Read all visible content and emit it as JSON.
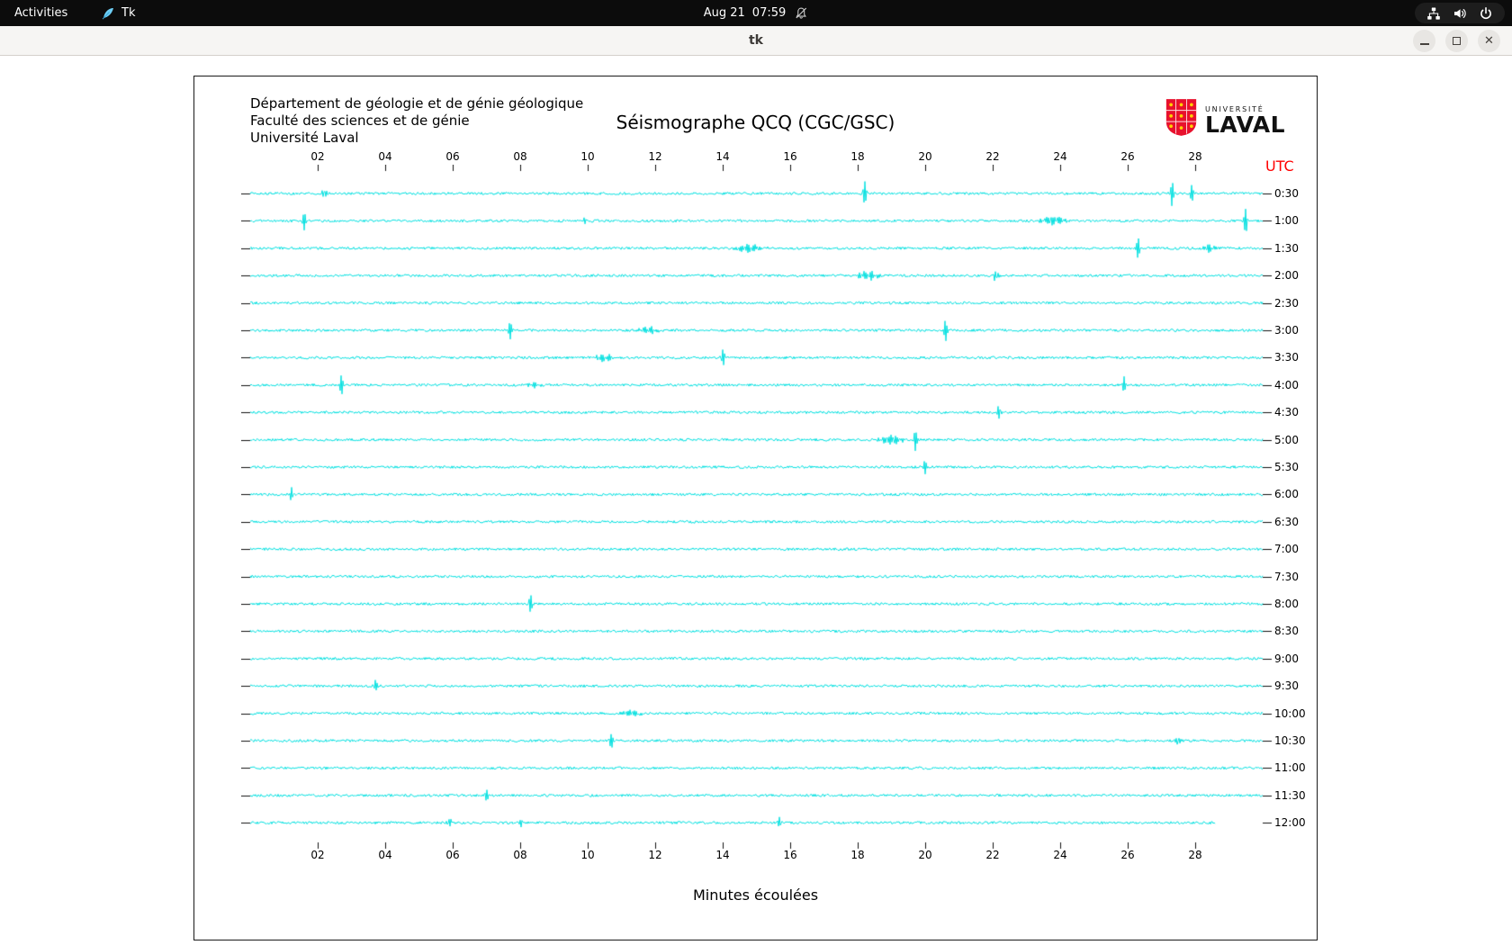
{
  "top_bar": {
    "activities_label": "Activities",
    "tk_label": "Tk",
    "clock_date": "Aug 21",
    "clock_time": "07:59"
  },
  "window": {
    "title": "tk"
  },
  "seismograph": {
    "org_lines": [
      "Département de géologie et de génie géologique",
      "Faculté des sciences et de génie",
      "Université Laval"
    ],
    "title": "Séismographe QCQ (CGC/GSC)",
    "logo": {
      "top": "UNIVERSITÉ",
      "bottom": "LAVAL"
    },
    "utc_label": "UTC",
    "x_label": "Minutes écoulées",
    "x_ticks": [
      "02",
      "04",
      "06",
      "08",
      "10",
      "12",
      "14",
      "16",
      "18",
      "20",
      "22",
      "24",
      "26",
      "28"
    ],
    "trace_color": "#00e0e0",
    "rows": [
      {
        "label": "0:30",
        "spikes": [
          [
            2.2,
            12,
            2
          ],
          [
            18.2,
            14,
            2
          ],
          [
            27.3,
            16,
            2
          ],
          [
            27.9,
            9,
            2
          ]
        ]
      },
      {
        "label": "1:00",
        "spikes": [
          [
            1.6,
            10,
            2
          ],
          [
            9.9,
            6,
            2
          ],
          [
            23.8,
            5,
            12
          ],
          [
            29.5,
            14,
            2
          ]
        ]
      },
      {
        "label": "1:30",
        "spikes": [
          [
            14.8,
            5,
            14
          ],
          [
            26.3,
            11,
            2
          ],
          [
            28.4,
            4,
            6
          ]
        ]
      },
      {
        "label": "2:00",
        "spikes": [
          [
            18.3,
            5,
            12
          ],
          [
            22.1,
            12,
            2
          ]
        ]
      },
      {
        "label": "2:30",
        "spikes": []
      },
      {
        "label": "3:00",
        "spikes": [
          [
            7.7,
            11,
            2
          ],
          [
            11.8,
            4,
            10
          ],
          [
            20.6,
            12,
            2
          ]
        ]
      },
      {
        "label": "3:30",
        "spikes": [
          [
            10.5,
            4,
            10
          ],
          [
            14.0,
            12,
            2
          ]
        ]
      },
      {
        "label": "4:00",
        "spikes": [
          [
            2.7,
            11,
            2
          ],
          [
            8.4,
            3,
            6
          ],
          [
            25.9,
            11,
            2
          ]
        ]
      },
      {
        "label": "4:30",
        "spikes": [
          [
            22.2,
            12,
            2
          ]
        ]
      },
      {
        "label": "5:00",
        "spikes": [
          [
            19.0,
            5,
            12
          ],
          [
            19.7,
            12,
            2
          ]
        ]
      },
      {
        "label": "5:30",
        "spikes": [
          [
            20.0,
            8,
            2
          ]
        ]
      },
      {
        "label": "6:00",
        "spikes": [
          [
            1.2,
            10,
            2
          ]
        ]
      },
      {
        "label": "6:30",
        "spikes": []
      },
      {
        "label": "7:00",
        "spikes": []
      },
      {
        "label": "7:30",
        "spikes": []
      },
      {
        "label": "8:00",
        "spikes": [
          [
            8.3,
            10,
            2
          ]
        ]
      },
      {
        "label": "8:30",
        "spikes": []
      },
      {
        "label": "9:00",
        "spikes": []
      },
      {
        "label": "9:30",
        "spikes": [
          [
            3.7,
            9,
            2
          ]
        ]
      },
      {
        "label": "10:00",
        "spikes": [
          [
            11.3,
            4,
            10
          ]
        ]
      },
      {
        "label": "10:30",
        "spikes": [
          [
            10.7,
            9,
            2
          ],
          [
            27.5,
            8,
            2
          ]
        ]
      },
      {
        "label": "11:00",
        "spikes": []
      },
      {
        "label": "11:30",
        "spikes": [
          [
            7.0,
            8,
            2
          ]
        ]
      },
      {
        "label": "12:00",
        "end_minute": 28.6,
        "spikes": [
          [
            5.9,
            7,
            2
          ],
          [
            8.0,
            6,
            2
          ],
          [
            15.7,
            10,
            2
          ]
        ]
      }
    ]
  }
}
